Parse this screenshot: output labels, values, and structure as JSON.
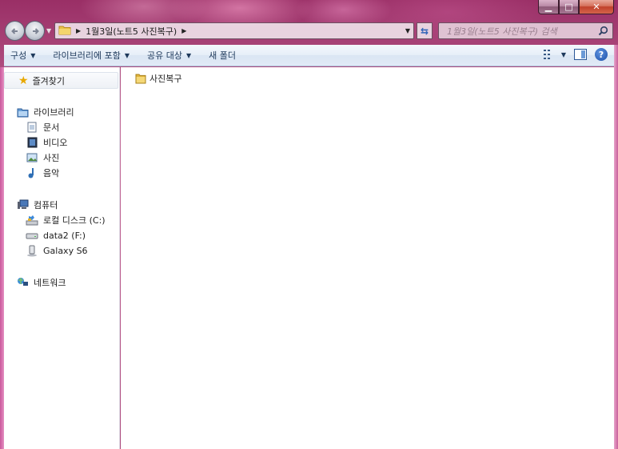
{
  "window": {
    "caption": {
      "minimize": "▁",
      "maximize": "□",
      "close": "✕"
    }
  },
  "navigation": {
    "back_icon": "back-arrow-icon",
    "forward_icon": "forward-arrow-icon",
    "address_crumb": "1월3일(노트5 사진복구)",
    "search_placeholder": "1월3일(노트5 사진복구) 검색"
  },
  "toolbar": {
    "items": [
      {
        "label": "구성"
      },
      {
        "label": "라이브러리에 포함"
      },
      {
        "label": "공유 대상"
      },
      {
        "label": "새 폴더"
      }
    ]
  },
  "navpane": {
    "favorites": "즐겨찾기",
    "libraries": {
      "label": "라이브러리",
      "items": [
        "문서",
        "비디오",
        "사진",
        "음악"
      ]
    },
    "computer": {
      "label": "컴퓨터",
      "items": [
        "로컬 디스크 (C:)",
        "data2 (F:)",
        "Galaxy S6"
      ]
    },
    "network": "네트워크"
  },
  "content": {
    "items": [
      {
        "name": "사진복구",
        "type": "folder"
      }
    ]
  },
  "colors": {
    "frame": "#b0487f",
    "toolbar_text": "#1e395b",
    "folder_yellow": "#e8c24a"
  }
}
